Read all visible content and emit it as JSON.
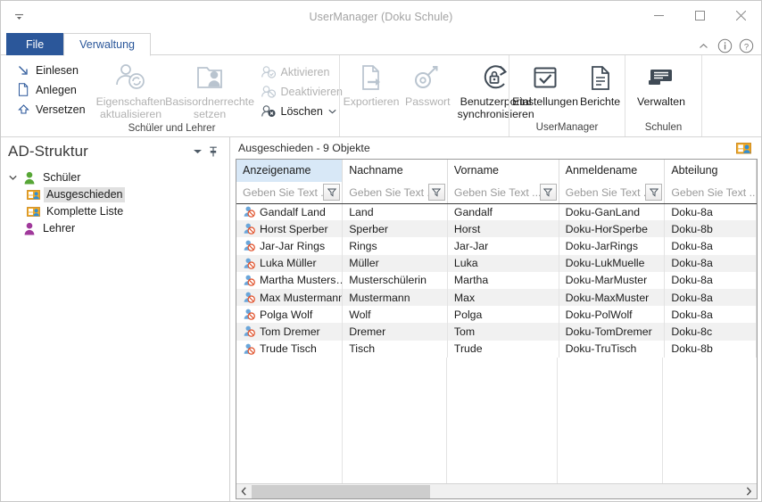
{
  "window": {
    "title": "UserManager (Doku Schule)",
    "quick_access_icon": "quick-access-dropdown-icon",
    "minimize_label": "Minimieren",
    "maximize_label": "Maximieren",
    "close_label": "Schließen"
  },
  "tabs": {
    "file_label": "File",
    "active_label": "Verwaltung",
    "collapse_icon": "chevron-up-icon",
    "info_icon": "info-icon",
    "help_icon": "help-icon"
  },
  "ribbon": {
    "groups": [
      {
        "label": "Schüler und Lehrer",
        "small_buttons": [
          {
            "label": "Einlesen",
            "icon": "import-arrow-icon",
            "disabled": false
          },
          {
            "label": "Anlegen",
            "icon": "new-page-icon",
            "disabled": false
          },
          {
            "label": "Versetzen",
            "icon": "promote-arrow-icon",
            "disabled": false
          }
        ],
        "large_buttons": [
          {
            "label": "Eigenschaften aktualisieren",
            "icon": "user-refresh-icon",
            "disabled": true
          },
          {
            "label": "Basisordnerrechte setzen",
            "icon": "folder-user-icon",
            "disabled": true
          }
        ],
        "small_buttons_2": [
          {
            "label": "Aktivieren",
            "icon": "user-enable-icon",
            "disabled": true
          },
          {
            "label": "Deaktivieren",
            "icon": "user-disable-icon",
            "disabled": true
          },
          {
            "label": "Löschen",
            "icon": "user-delete-icon",
            "disabled": false,
            "dropdown": true
          }
        ]
      },
      {
        "label": "",
        "large_buttons": [
          {
            "label": "Exportieren",
            "icon": "export-page-icon",
            "disabled": true
          },
          {
            "label": "Passwort",
            "icon": "password-key-icon",
            "disabled": true
          },
          {
            "label": "Benutzerportal synchronisieren",
            "icon": "sync-lock-icon",
            "disabled": false
          }
        ]
      },
      {
        "label": "UserManager",
        "large_buttons": [
          {
            "label": "Einstellungen",
            "icon": "settings-check-icon",
            "disabled": false
          },
          {
            "label": "Berichte",
            "icon": "report-page-icon",
            "disabled": false
          }
        ]
      },
      {
        "label": "Schulen",
        "large_buttons": [
          {
            "label": "Verwalten",
            "icon": "manage-school-icon",
            "disabled": false
          }
        ]
      }
    ]
  },
  "sidebar": {
    "title": "AD-Struktur",
    "dropdown_icon": "chevron-down-icon",
    "pin_icon": "pin-icon",
    "tree": [
      {
        "label": "Schüler",
        "level": 1,
        "icon": "user-green-icon",
        "expanded": true,
        "selected": false
      },
      {
        "label": "Ausgeschieden",
        "level": 2,
        "icon": "ou-folder-icon",
        "expanded": null,
        "selected": true
      },
      {
        "label": "Komplette Liste",
        "level": 2,
        "icon": "ou-folder-icon",
        "expanded": null,
        "selected": false
      },
      {
        "label": "Lehrer",
        "level": 1,
        "icon": "user-purple-icon",
        "expanded": null,
        "selected": false
      }
    ]
  },
  "grid": {
    "caption": "Ausgeschieden - 9 Objekte",
    "caption_icon": "ou-folder-icon",
    "filter_icon": "funnel-icon",
    "filter_placeholder": "Geben Sie Text ...",
    "sorted_column": "Anzeigename",
    "columns": [
      {
        "label": "Anzeigename",
        "width": 118,
        "sorted": true,
        "has_filter_button": true
      },
      {
        "label": "Nachname",
        "width": 117,
        "sorted": false,
        "has_filter_button": true
      },
      {
        "label": "Vorname",
        "width": 124,
        "sorted": false,
        "has_filter_button": true
      },
      {
        "label": "Anmeldename",
        "width": 118,
        "sorted": false,
        "has_filter_button": true
      },
      {
        "label": "Abteilung",
        "width": 102,
        "sorted": false,
        "has_filter_button": false
      }
    ],
    "row_icon": "user-disabled-icon",
    "rows": [
      {
        "anzeigename": "Gandalf Land",
        "nachname": "Land",
        "vorname": "Gandalf",
        "anmeldename": "Doku-GanLand",
        "abteilung": "Doku-8a"
      },
      {
        "anzeigename": "Horst Sperber",
        "nachname": "Sperber",
        "vorname": "Horst",
        "anmeldename": "Doku-HorSperbe",
        "abteilung": "Doku-8b"
      },
      {
        "anzeigename": "Jar-Jar Rings",
        "nachname": "Rings",
        "vorname": "Jar-Jar",
        "anmeldename": "Doku-JarRings",
        "abteilung": "Doku-8a"
      },
      {
        "anzeigename": "Luka Müller",
        "nachname": "Müller",
        "vorname": "Luka",
        "anmeldename": "Doku-LukMuelle",
        "abteilung": "Doku-8a"
      },
      {
        "anzeigename": "Martha Musters…",
        "nachname": "Musterschülerin",
        "vorname": "Martha",
        "anmeldename": "Doku-MarMuster",
        "abteilung": "Doku-8a"
      },
      {
        "anzeigename": "Max Mustermann",
        "nachname": "Mustermann",
        "vorname": "Max",
        "anmeldename": "Doku-MaxMuster",
        "abteilung": "Doku-8a"
      },
      {
        "anzeigename": "Polga Wolf",
        "nachname": "Wolf",
        "vorname": "Polga",
        "anmeldename": "Doku-PolWolf",
        "abteilung": "Doku-8a"
      },
      {
        "anzeigename": "Tom Dremer",
        "nachname": "Dremer",
        "vorname": "Tom",
        "anmeldename": "Doku-TomDremer",
        "abteilung": "Doku-8c"
      },
      {
        "anzeigename": "Trude Tisch",
        "nachname": "Tisch",
        "vorname": "Trude",
        "anmeldename": "Doku-TruTisch",
        "abteilung": "Doku-8b"
      }
    ],
    "scrollbar": {
      "left_arrow_icon": "chevron-left-icon",
      "right_arrow_icon": "chevron-right-icon"
    }
  },
  "colors": {
    "file_tab": "#2b579a",
    "active_tab_text": "#2b579a",
    "sorted_header": "#d8e8f7",
    "selection": "#e0e0e0",
    "alt_row": "#f1f1f1",
    "disabled_text": "#b2b2b2"
  }
}
